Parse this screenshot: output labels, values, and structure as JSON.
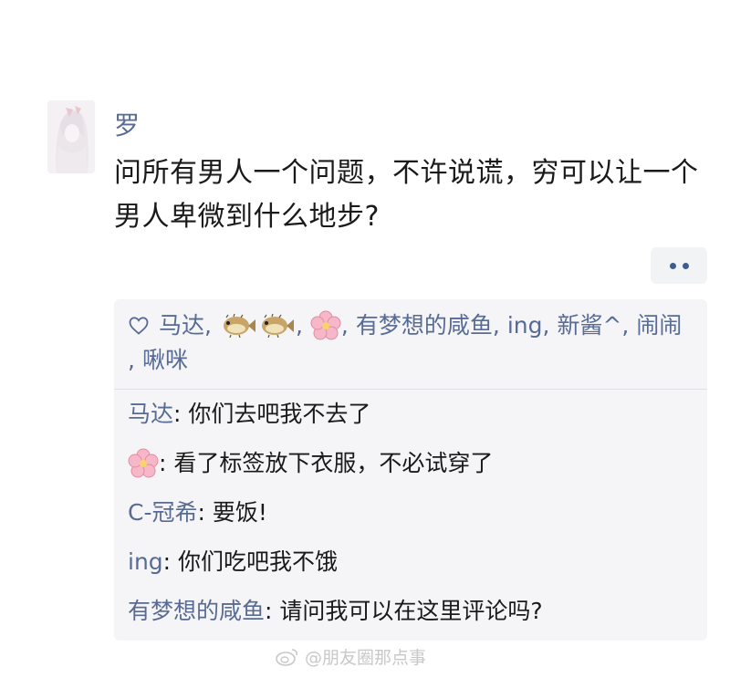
{
  "post": {
    "author": "罗",
    "content": "问所有男人一个问题，不许说谎，穷可以让一个男人卑微到什么地步?"
  },
  "likes": {
    "names": [
      "马达",
      "🐡🐡",
      "🌸",
      "有梦想的咸鱼",
      "ing",
      "新酱^",
      "闹闹",
      "啾咪"
    ],
    "separator": ","
  },
  "comments": [
    {
      "name": "马达",
      "text": ": 你们去吧我不去了"
    },
    {
      "name": "🌸",
      "text": ": 看了标签放下衣服，不必试穿了"
    },
    {
      "name": "C-冠希",
      "text": ": 要饭!"
    },
    {
      "name": "ing",
      "text": ": 你们吃吧我不饿"
    },
    {
      "name": "有梦想的咸鱼",
      "text": ": 请问我可以在这里评论吗?"
    }
  ],
  "watermark": "@朋友圈那点事",
  "colors": {
    "link": "#576b95",
    "panel": "#f5f5f7",
    "text": "#1a1a1a"
  },
  "icons": {
    "like": "heart-outline-icon",
    "more": "ellipsis-icon",
    "watermark": "weibo-logo-icon"
  }
}
